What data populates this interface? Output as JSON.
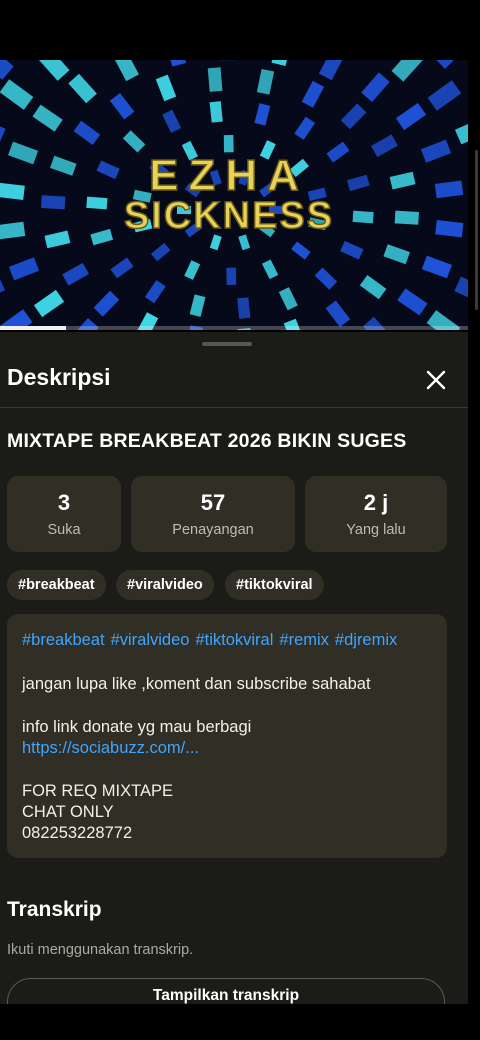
{
  "video": {
    "overlay_title_top": "EZHA",
    "overlay_title_bottom": "SICKNESS",
    "progress": 0.14,
    "colors": {
      "background": "#06091a",
      "tile_blue": "#1f52d8",
      "tile_cyan": "#3fd6e6",
      "text_gold": "#e8d35a"
    }
  },
  "panel": {
    "title": "Deskripsi",
    "close_icon": "close-icon"
  },
  "video_title": "MIXTAPE BREAKBEAT 2026 BIKIN SUGES",
  "stats": [
    {
      "value": "3",
      "label": "Suka"
    },
    {
      "value": "57",
      "label": "Penayangan"
    },
    {
      "value": "2 j",
      "label": "Yang lalu"
    }
  ],
  "chips": [
    "#breakbeat",
    "#viralvideo",
    "#tiktokviral"
  ],
  "description": {
    "hashtags": [
      "#breakbeat",
      "#viralvideo",
      "#tiktokviral",
      "#remix",
      "#djremix"
    ],
    "line1": "jangan lupa like ,koment dan subscribe sahabat",
    "line2": "info link donate yg mau berbagi",
    "link": "https://sociabuzz.com/...",
    "line3": "FOR REQ MIXTAPE",
    "line4": "CHAT ONLY",
    "line5": "082253228772"
  },
  "transcript": {
    "title": "Transkrip",
    "subtitle": "Ikuti menggunakan transkrip.",
    "button_label": "Tampilkan transkrip"
  },
  "colors": {
    "sheet_bg": "#1b1b17",
    "card_bg": "#312e25",
    "link": "#3ea6ff"
  }
}
